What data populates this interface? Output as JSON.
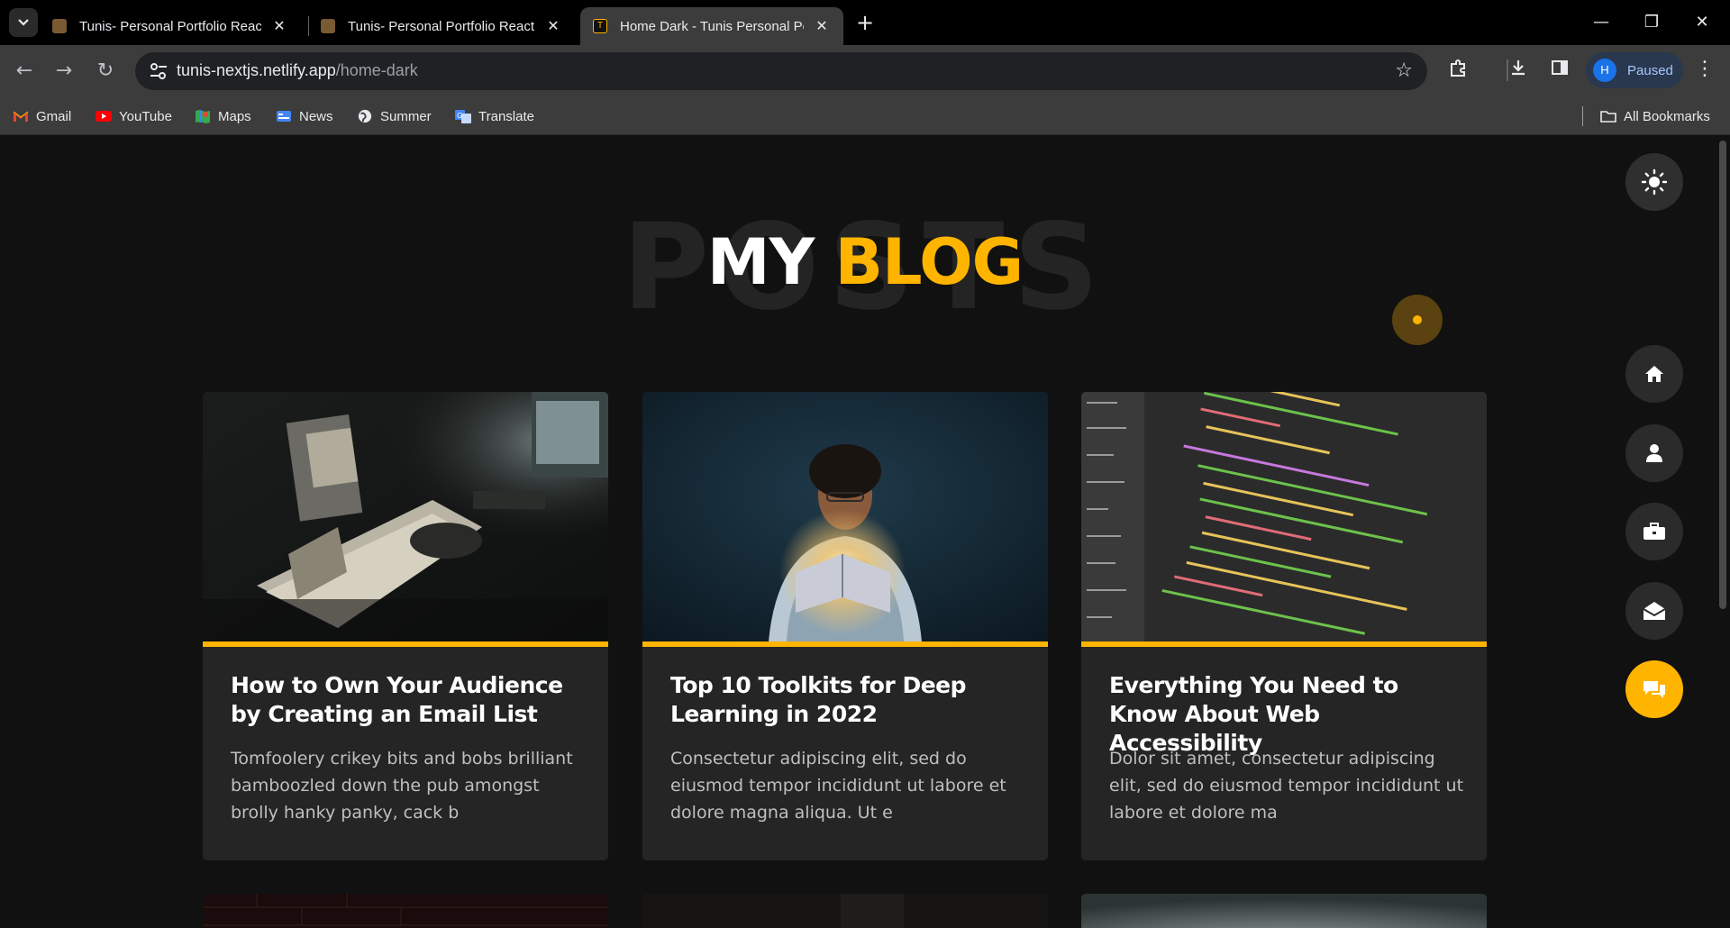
{
  "browser": {
    "tabs": [
      {
        "title": "Tunis- Personal Portfolio React",
        "active": false
      },
      {
        "title": "Tunis- Personal Portfolio React",
        "active": false
      },
      {
        "title": "Home Dark - Tunis Personal Por",
        "active": true
      }
    ],
    "url_host": "tunis-nextjs.netlify.app",
    "url_path": "/home-dark",
    "profile_initial": "H",
    "profile_status": "Paused",
    "bookmarks": [
      "Gmail",
      "YouTube",
      "Maps",
      "News",
      "Summer",
      "Translate"
    ],
    "all_bookmarks": "All Bookmarks",
    "colors": {
      "tabbar": "#000000",
      "toolbar": "#3c3c3c",
      "omnibox": "#202124"
    }
  },
  "page": {
    "bg_title": "POSTS",
    "heading_main": "MY",
    "heading_accent": "BLOG",
    "colors": {
      "accent": "#ffb400",
      "background": "#111111",
      "card": "#252525"
    },
    "posts": [
      {
        "title": "How to Own Your Audience by Creating an Email List",
        "excerpt": "Tomfoolery crikey bits and bobs brilliant bamboozled down the pub amongst brolly hanky panky, cack b",
        "image": "desk-with-papers-photo"
      },
      {
        "title": "Top 10 Toolkits for Deep Learning in 2022",
        "excerpt": "Consectetur adipiscing elit, sed do eiusmod tempor incididunt ut labore et dolore magna aliqua. Ut e",
        "image": "man-reading-glowing-book-photo"
      },
      {
        "title": "Everything You Need to Know About Web Accessibility",
        "excerpt": "Dolor sit amet, consectetur adipiscing elit, sed do eiusmod tempor incididunt ut labore et dolore ma",
        "image": "code-editor-screenshot"
      }
    ],
    "side_nav": [
      {
        "icon": "home-icon",
        "active": false
      },
      {
        "icon": "user-icon",
        "active": false
      },
      {
        "icon": "briefcase-icon",
        "active": false
      },
      {
        "icon": "envelope-open-icon",
        "active": false
      },
      {
        "icon": "comments-icon",
        "active": true
      }
    ],
    "theme_toggle_icon": "sun-icon"
  }
}
